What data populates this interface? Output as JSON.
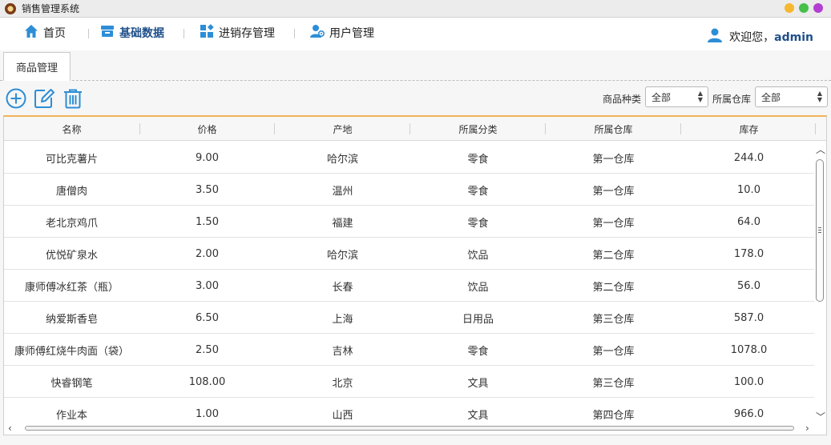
{
  "window": {
    "title": "销售管理系统"
  },
  "nav": {
    "items": [
      {
        "label": "首页",
        "icon": "home-icon"
      },
      {
        "label": "基础数据",
        "icon": "database-icon",
        "active": true
      },
      {
        "label": "进销存管理",
        "icon": "inventory-icon"
      },
      {
        "label": "用户管理",
        "icon": "user-settings-icon"
      }
    ],
    "welcome_text": "欢迎您，",
    "username": "admin"
  },
  "tabs": [
    {
      "label": "商品管理",
      "active": true
    }
  ],
  "toolbar": {
    "buttons": [
      {
        "name": "add-button",
        "icon": "add-circle-icon"
      },
      {
        "name": "edit-button",
        "icon": "edit-icon"
      },
      {
        "name": "delete-button",
        "icon": "trash-icon"
      }
    ],
    "filters": {
      "category_label": "商品种类",
      "category_value": "全部",
      "warehouse_label": "所属仓库",
      "warehouse_value": "全部"
    }
  },
  "table": {
    "columns": [
      "名称",
      "价格",
      "产地",
      "所属分类",
      "所属仓库",
      "库存"
    ],
    "rows": [
      [
        "可比克薯片",
        "9.00",
        "哈尔滨",
        "零食",
        "第一仓库",
        "244.0"
      ],
      [
        "唐僧肉",
        "3.50",
        "温州",
        "零食",
        "第一仓库",
        "10.0"
      ],
      [
        "老北京鸡爪",
        "1.50",
        "福建",
        "零食",
        "第一仓库",
        "64.0"
      ],
      [
        "优悦矿泉水",
        "2.00",
        "哈尔滨",
        "饮品",
        "第二仓库",
        "178.0"
      ],
      [
        "康师傅冰红茶（瓶）",
        "3.00",
        "长春",
        "饮品",
        "第二仓库",
        "56.0"
      ],
      [
        "纳爱斯香皂",
        "6.50",
        "上海",
        "日用品",
        "第三仓库",
        "587.0"
      ],
      [
        "康师傅红烧牛肉面（袋）",
        "2.50",
        "吉林",
        "零食",
        "第一仓库",
        "1078.0"
      ],
      [
        "快睿钢笔",
        "108.00",
        "北京",
        "文具",
        "第三仓库",
        "100.0"
      ],
      [
        "作业本",
        "1.00",
        "山西",
        "文具",
        "第四仓库",
        "966.0"
      ]
    ]
  },
  "colors": {
    "accent": "#1f4f8a",
    "icon_blue": "#2d8ed6",
    "header_top_border": "#f0b257",
    "traffic_yellow": "#f5b82e",
    "traffic_green": "#46c04a",
    "traffic_purple": "#b33fd0"
  }
}
